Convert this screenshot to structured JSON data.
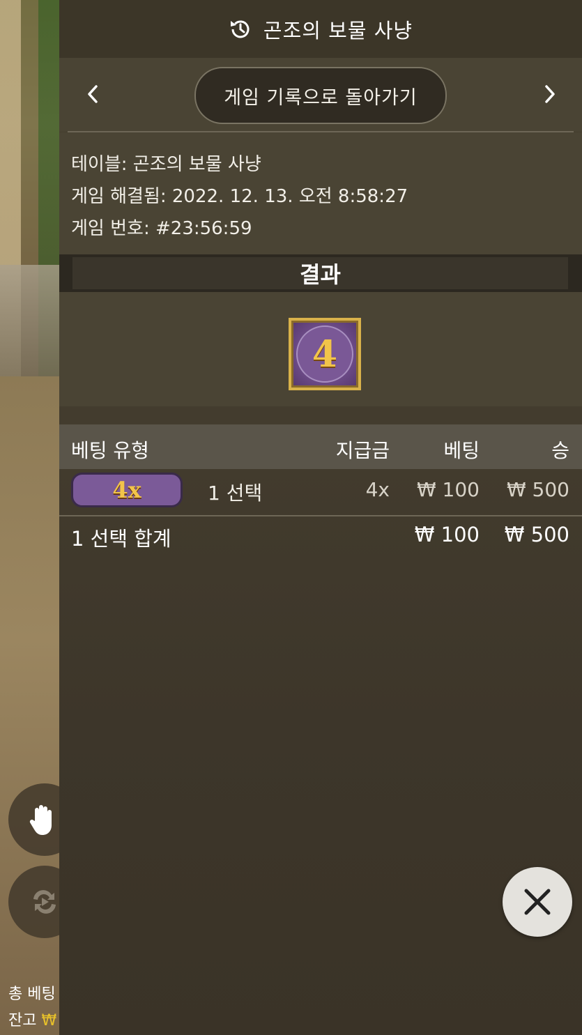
{
  "header": {
    "title": "곤조의 보물 사냥",
    "icon": "history-icon"
  },
  "nav": {
    "back_label": "게임 기록으로 돌아가기",
    "prev_icon": "chevron-left-icon",
    "next_icon": "chevron-right-icon"
  },
  "info": {
    "table": "테이블: 곤조의 보물 사냥",
    "resolved": "게임 해결됨: 2022. 12. 13. 오전 8:58:27",
    "game_number": "게임 번호: #23:56:59"
  },
  "result": {
    "heading": "결과",
    "value": "4"
  },
  "table": {
    "headers": {
      "type": "베팅 유형",
      "payout": "지급금",
      "bet": "베팅",
      "win": "승"
    },
    "rows": [
      {
        "chip": "4x",
        "label": "1 선택",
        "payout": "4x",
        "bet": "₩ 100",
        "win": "₩ 500"
      }
    ],
    "total": {
      "label": "1 선택 합계",
      "bet": "₩ 100",
      "win": "₩ 500"
    }
  },
  "background": {
    "total_bet_label": "총 베팅",
    "balance_label": "잔고",
    "balance_currency": "₩"
  },
  "colors": {
    "panel_bg": "#4a4434",
    "accent_gold": "#d9b24a",
    "tile_purple": "#6b4a86",
    "balance_yellow": "#e8c12a"
  }
}
